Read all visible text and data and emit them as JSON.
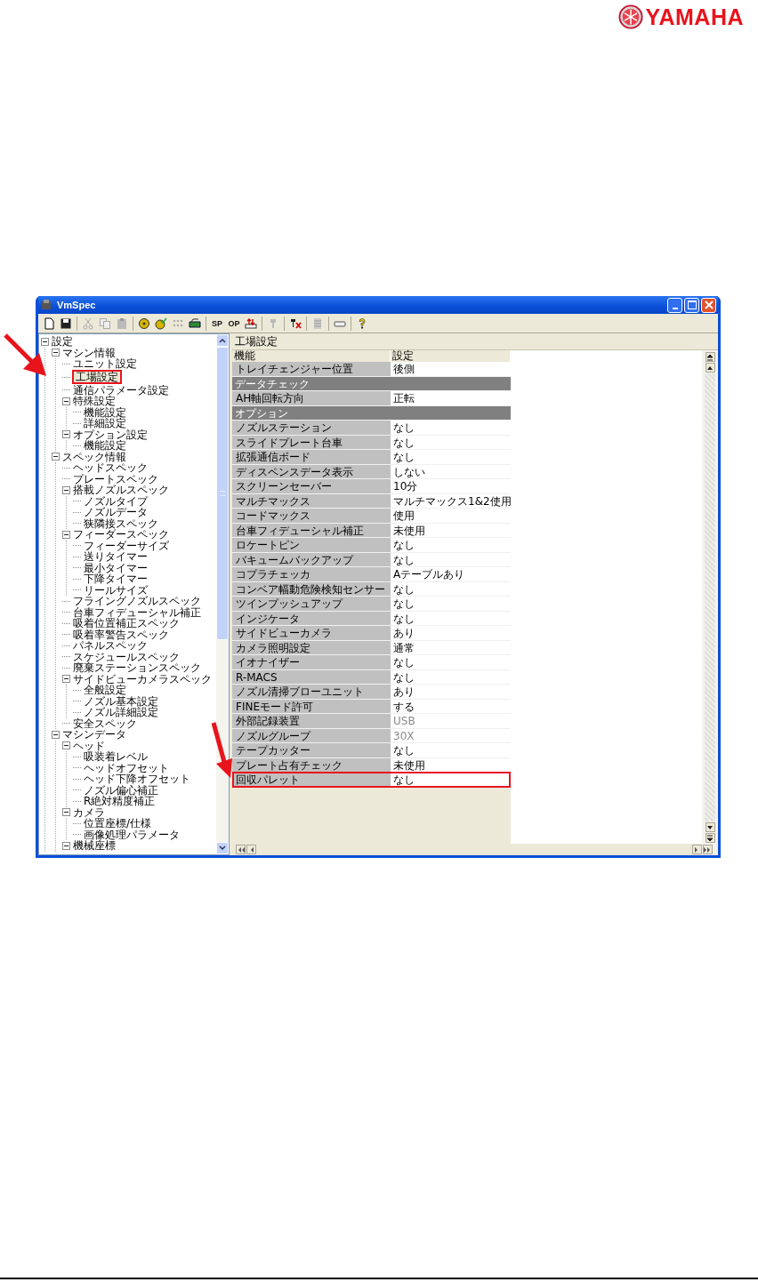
{
  "logo": {
    "text": "YAMAHA"
  },
  "window": {
    "title": "VmSpec"
  },
  "toolbar": {
    "text_buttons": [
      "SP",
      "OP"
    ]
  },
  "tree": [
    {
      "label": "設定",
      "selected": false,
      "highlighted": false,
      "expanded": true,
      "children": [
        {
          "label": "マシン情報",
          "selected": false,
          "highlighted": false,
          "expanded": true,
          "children": [
            {
              "label": "ユニット設定",
              "selected": false,
              "highlighted": false
            },
            {
              "label": "工場設定",
              "selected": true,
              "highlighted": true
            },
            {
              "label": "通信パラメータ設定",
              "selected": false,
              "highlighted": false
            },
            {
              "label": "特殊設定",
              "selected": false,
              "highlighted": false,
              "expanded": true,
              "children": [
                {
                  "label": "機能設定",
                  "selected": false,
                  "highlighted": false
                },
                {
                  "label": "詳細設定",
                  "selected": false,
                  "highlighted": false
                }
              ]
            },
            {
              "label": "オプション設定",
              "selected": false,
              "highlighted": false,
              "expanded": true,
              "children": [
                {
                  "label": "機能設定",
                  "selected": false,
                  "highlighted": false
                }
              ]
            }
          ]
        },
        {
          "label": "スペック情報",
          "selected": false,
          "highlighted": false,
          "expanded": true,
          "children": [
            {
              "label": "ヘッドスペック",
              "selected": false,
              "highlighted": false
            },
            {
              "label": "プレートスペック",
              "selected": false,
              "highlighted": false
            },
            {
              "label": "搭載ノズルスペック",
              "selected": false,
              "highlighted": false,
              "expanded": true,
              "children": [
                {
                  "label": "ノズルタイプ",
                  "selected": false,
                  "highlighted": false
                },
                {
                  "label": "ノズルデータ",
                  "selected": false,
                  "highlighted": false
                },
                {
                  "label": "狭隣接スペック",
                  "selected": false,
                  "highlighted": false
                }
              ]
            },
            {
              "label": "フィーダースペック",
              "selected": false,
              "highlighted": false,
              "expanded": true,
              "children": [
                {
                  "label": "フィーダーサイズ",
                  "selected": false,
                  "highlighted": false
                },
                {
                  "label": "送りタイマー",
                  "selected": false,
                  "highlighted": false
                },
                {
                  "label": "最小タイマー",
                  "selected": false,
                  "highlighted": false
                },
                {
                  "label": "下降タイマー",
                  "selected": false,
                  "highlighted": false
                },
                {
                  "label": "リールサイズ",
                  "selected": false,
                  "highlighted": false
                }
              ]
            },
            {
              "label": "フライングノズルスペック",
              "selected": false,
              "highlighted": false
            },
            {
              "label": "台車フィデューシャル補正",
              "selected": false,
              "highlighted": false
            },
            {
              "label": "吸着位置補正スペック",
              "selected": false,
              "highlighted": false
            },
            {
              "label": "吸着率警告スペック",
              "selected": false,
              "highlighted": false
            },
            {
              "label": "パネルスペック",
              "selected": false,
              "highlighted": false
            },
            {
              "label": "スケジュールスペック",
              "selected": false,
              "highlighted": false
            },
            {
              "label": "廃棄ステーションスペック",
              "selected": false,
              "highlighted": false
            },
            {
              "label": "サイドビューカメラスペック",
              "selected": false,
              "highlighted": false,
              "expanded": true,
              "children": [
                {
                  "label": "全般設定",
                  "selected": false,
                  "highlighted": false
                },
                {
                  "label": "ノズル基本設定",
                  "selected": false,
                  "highlighted": false
                },
                {
                  "label": "ノズル詳細設定",
                  "selected": false,
                  "highlighted": false
                }
              ]
            },
            {
              "label": "安全スペック",
              "selected": false,
              "highlighted": false
            }
          ]
        },
        {
          "label": "マシンデータ",
          "selected": false,
          "highlighted": false,
          "expanded": true,
          "children": [
            {
              "label": "ヘッド",
              "selected": false,
              "highlighted": false,
              "expanded": true,
              "children": [
                {
                  "label": "吸装着レベル",
                  "selected": false,
                  "highlighted": false
                },
                {
                  "label": "ヘッドオフセット",
                  "selected": false,
                  "highlighted": false
                },
                {
                  "label": "ヘッド下降オフセット",
                  "selected": false,
                  "highlighted": false
                },
                {
                  "label": "ノズル偏心補正",
                  "selected": false,
                  "highlighted": false
                },
                {
                  "label": "R絶対精度補正",
                  "selected": false,
                  "highlighted": false
                }
              ]
            },
            {
              "label": "カメラ",
              "selected": false,
              "highlighted": false,
              "expanded": true,
              "children": [
                {
                  "label": "位置座標/仕様",
                  "selected": false,
                  "highlighted": false
                },
                {
                  "label": "画像処理パラメータ",
                  "selected": false,
                  "highlighted": false
                }
              ]
            },
            {
              "label": "機械座標",
              "selected": false,
              "highlighted": false,
              "expanded": true
            }
          ]
        }
      ]
    }
  ],
  "panel": {
    "title": "工場設定",
    "columns": [
      "機能",
      "設定"
    ],
    "rows": [
      {
        "kind": "setting",
        "name": "トレイチェンジャー位置",
        "value": "後側",
        "disabled": false,
        "highlighted": false
      },
      {
        "kind": "group",
        "name": "データチェック"
      },
      {
        "kind": "setting",
        "name": "AH軸回転方向",
        "value": "正転",
        "disabled": false,
        "highlighted": false
      },
      {
        "kind": "group",
        "name": "オプション"
      },
      {
        "kind": "setting",
        "name": "ノズルステーション",
        "value": "なし",
        "disabled": false,
        "highlighted": false
      },
      {
        "kind": "setting",
        "name": "スライドプレート台車",
        "value": "なし",
        "disabled": false,
        "highlighted": false
      },
      {
        "kind": "setting",
        "name": "拡張通信ボード",
        "value": "なし",
        "disabled": false,
        "highlighted": false
      },
      {
        "kind": "setting",
        "name": "ディスペンスデータ表示",
        "value": "しない",
        "disabled": false,
        "highlighted": false
      },
      {
        "kind": "setting",
        "name": "スクリーンセーバー",
        "value": "10分",
        "disabled": false,
        "highlighted": false
      },
      {
        "kind": "setting",
        "name": "マルチマックス",
        "value": "マルチマックス1&2使用",
        "disabled": false,
        "highlighted": false
      },
      {
        "kind": "setting",
        "name": "コードマックス",
        "value": "使用",
        "disabled": false,
        "highlighted": false
      },
      {
        "kind": "setting",
        "name": "台車フィデューシャル補正",
        "value": "未使用",
        "disabled": false,
        "highlighted": false
      },
      {
        "kind": "setting",
        "name": "ロケートピン",
        "value": "なし",
        "disabled": false,
        "highlighted": false
      },
      {
        "kind": "setting",
        "name": "バキュームバックアップ",
        "value": "なし",
        "disabled": false,
        "highlighted": false
      },
      {
        "kind": "setting",
        "name": "コプラチェッカ",
        "value": "Aテーブルあり",
        "disabled": false,
        "highlighted": false
      },
      {
        "kind": "setting",
        "name": "コンベア幅動危険検知センサー",
        "value": "なし",
        "disabled": false,
        "highlighted": false
      },
      {
        "kind": "setting",
        "name": "ツインプッシュアップ",
        "value": "なし",
        "disabled": false,
        "highlighted": false
      },
      {
        "kind": "setting",
        "name": "インジケータ",
        "value": "なし",
        "disabled": false,
        "highlighted": false
      },
      {
        "kind": "setting",
        "name": "サイドビューカメラ",
        "value": "あり",
        "disabled": false,
        "highlighted": false
      },
      {
        "kind": "setting",
        "name": "カメラ照明設定",
        "value": "通常",
        "disabled": false,
        "highlighted": false
      },
      {
        "kind": "setting",
        "name": "イオナイザー",
        "value": "なし",
        "disabled": false,
        "highlighted": false
      },
      {
        "kind": "setting",
        "name": "R-MACS",
        "value": "なし",
        "disabled": false,
        "highlighted": false
      },
      {
        "kind": "setting",
        "name": "ノズル清掃ブローユニット",
        "value": "あり",
        "disabled": false,
        "highlighted": false
      },
      {
        "kind": "setting",
        "name": "FINEモード許可",
        "value": "する",
        "disabled": false,
        "highlighted": false
      },
      {
        "kind": "setting",
        "name": "外部記録装置",
        "value": "USB",
        "disabled": true,
        "highlighted": false
      },
      {
        "kind": "setting",
        "name": "ノズルグループ",
        "value": "30X",
        "disabled": true,
        "highlighted": false
      },
      {
        "kind": "setting",
        "name": "テープカッター",
        "value": "なし",
        "disabled": false,
        "highlighted": false
      },
      {
        "kind": "setting",
        "name": "プレート占有チェック",
        "value": "未使用",
        "disabled": false,
        "highlighted": false
      },
      {
        "kind": "setting",
        "name": "回収パレット",
        "value": "なし",
        "disabled": false,
        "highlighted": true
      }
    ]
  }
}
